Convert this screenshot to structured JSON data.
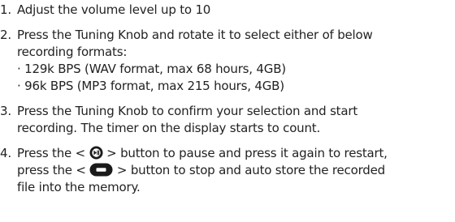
{
  "steps": [
    {
      "number": "1.",
      "text": "Adjust the volume level up to 10"
    },
    {
      "number": "2.",
      "line1": "Press the Tuning Knob and rotate it to select either of below",
      "line2": "recording formats:",
      "formats": [
        "· 129k BPS (WAV format, max 68 hours, 4GB)",
        "· 96k BPS (MP3 format, max 215 hours, 4GB)"
      ]
    },
    {
      "number": "3.",
      "line1": "Press the Tuning Knob to confirm your selection and start",
      "line2": "recording. The timer on the display starts to count."
    },
    {
      "number": "4.",
      "line1_pre": "Press the <",
      "line1_post": "> button to pause and press it again to restart,",
      "line2_pre": "press the <",
      "line2_post": "> button to stop and auto store the recorded",
      "line3": "file into the memory.",
      "icons": {
        "pause": "play-pause-button-icon",
        "stop": "stop-button-icon"
      }
    }
  ]
}
